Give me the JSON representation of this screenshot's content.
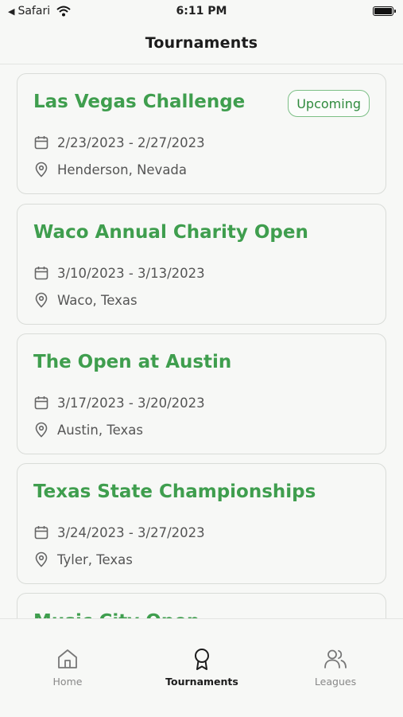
{
  "status_bar": {
    "back_app": "Safari",
    "time": "6:11 PM"
  },
  "header": {
    "title": "Tournaments"
  },
  "tournaments": [
    {
      "name": "Las Vegas Challenge",
      "status": "Upcoming",
      "dates": "2/23/2023 - 2/27/2023",
      "location": "Henderson, Nevada"
    },
    {
      "name": "Waco Annual Charity Open",
      "dates": "3/10/2023 - 3/13/2023",
      "location": "Waco, Texas"
    },
    {
      "name": "The Open at Austin",
      "dates": "3/17/2023 - 3/20/2023",
      "location": "Austin, Texas"
    },
    {
      "name": "Texas State Championships",
      "dates": "3/24/2023 - 3/27/2023",
      "location": "Tyler, Texas"
    },
    {
      "name": "Music City Open"
    }
  ],
  "tab_bar": {
    "tabs": [
      {
        "label": "Home",
        "icon": "home-icon"
      },
      {
        "label": "Tournaments",
        "icon": "award-icon",
        "active": true
      },
      {
        "label": "Leagues",
        "icon": "users-icon"
      }
    ]
  },
  "colors": {
    "accent": "#3f9e4e",
    "background": "#f7f8f6",
    "border": "#d9dcd8"
  }
}
